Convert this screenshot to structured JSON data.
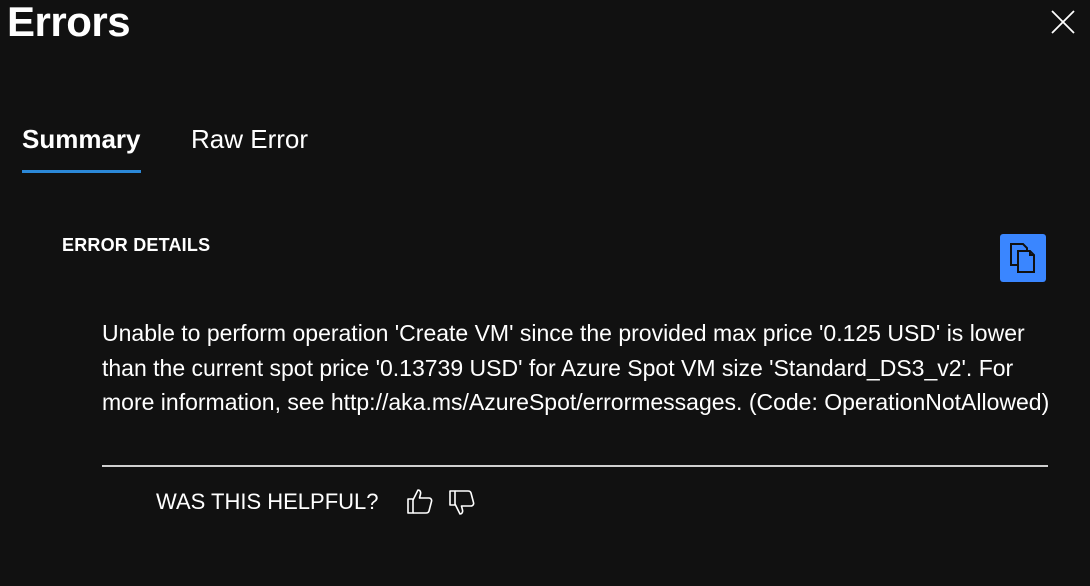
{
  "dialog": {
    "title": "Errors"
  },
  "tabs": [
    {
      "label": "Summary",
      "active": true
    },
    {
      "label": "Raw Error",
      "active": false
    }
  ],
  "details": {
    "section_label": "ERROR DETAILS",
    "message": "Unable to perform operation 'Create VM' since the provided max price '0.125 USD' is lower than the current spot price '0.13739 USD' for Azure Spot VM size 'Standard_DS3_v2'. For more information, see http://aka.ms/AzureSpot/errormessages. (Code: OperationNotAllowed)"
  },
  "feedback": {
    "prompt": "WAS THIS HELPFUL?"
  },
  "icons": {
    "close": "close-icon",
    "copy": "copy-icon",
    "thumbs_up": "thumbs-up-icon",
    "thumbs_down": "thumbs-down-icon"
  },
  "colors": {
    "background": "#111111",
    "accent": "#2b88d8",
    "copy_button": "#3a86ff",
    "text": "#ffffff"
  }
}
